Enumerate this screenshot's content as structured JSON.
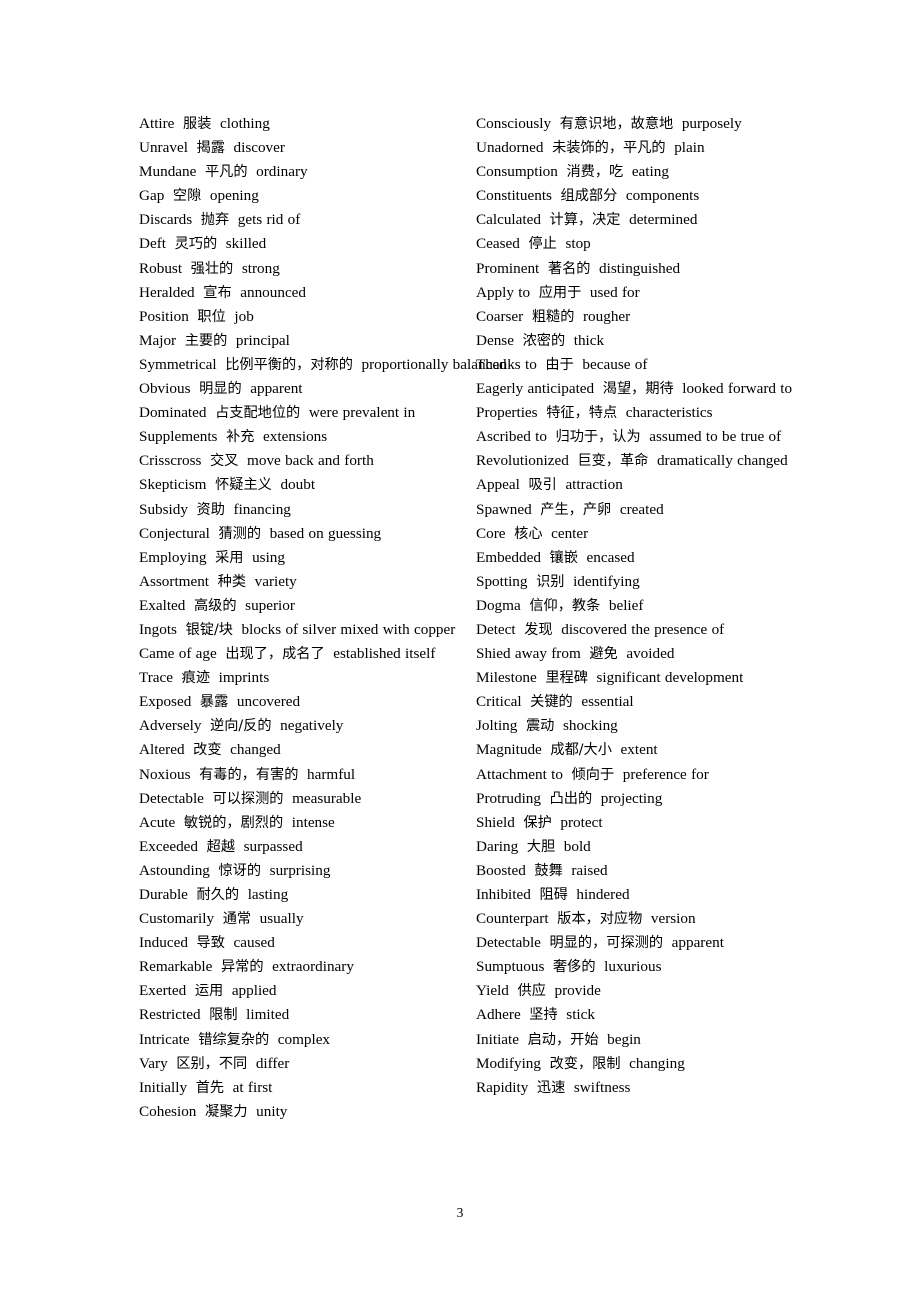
{
  "document": {
    "type": "vocabulary-glossary-page",
    "page_number": "3",
    "layout": "two-column",
    "background_color": "#ffffff",
    "text_color": "#000000"
  },
  "left_column": [
    {
      "en": "Attire",
      "cn": "服装",
      "syn": "clothing",
      "wrap": false
    },
    {
      "en": "Unravel",
      "cn": "揭露",
      "syn": "discover",
      "wrap": false
    },
    {
      "en": "Mundane",
      "cn": "平凡的",
      "syn": "ordinary",
      "wrap": false
    },
    {
      "en": "Gap",
      "cn": "空隙",
      "syn": "opening",
      "wrap": false
    },
    {
      "en": "Discards",
      "cn": "抛弃",
      "syn": "gets rid of",
      "wrap": false
    },
    {
      "en": "Deft",
      "cn": "灵巧的",
      "syn": "skilled",
      "wrap": false
    },
    {
      "en": "Robust",
      "cn": "强壮的",
      "syn": "strong",
      "wrap": false
    },
    {
      "en": "Heralded",
      "cn": "宣布",
      "syn": "announced",
      "wrap": false
    },
    {
      "en": "Position",
      "cn": "职位",
      "syn": "job",
      "wrap": false
    },
    {
      "en": "Major",
      "cn": "主要的",
      "syn": "principal",
      "wrap": false
    },
    {
      "en": "Symmetrical",
      "cn": "比例平衡的，对称的",
      "syn": "proportionally balanced",
      "wrap": true
    },
    {
      "en": "Obvious",
      "cn": "明显的",
      "syn": "apparent",
      "wrap": false
    },
    {
      "en": "Dominated",
      "cn": "占支配地位的",
      "syn": "were prevalent in",
      "wrap": false
    },
    {
      "en": "Supplements",
      "cn": "补充",
      "syn": "extensions",
      "wrap": false
    },
    {
      "en": "Crisscross",
      "cn": "交叉",
      "syn": "move back and forth",
      "wrap": false
    },
    {
      "en": "Skepticism",
      "cn": "怀疑主义",
      "syn": "doubt",
      "wrap": false
    },
    {
      "en": "Subsidy",
      "cn": "资助",
      "syn": "financing",
      "wrap": false
    },
    {
      "en": "Conjectural",
      "cn": "猜测的",
      "syn": "based on guessing",
      "wrap": false
    },
    {
      "en": "Employing",
      "cn": "采用",
      "syn": "using",
      "wrap": false
    },
    {
      "en": "Assortment",
      "cn": "种类",
      "syn": "variety",
      "wrap": false
    },
    {
      "en": "Exalted",
      "cn": "高级的",
      "syn": "superior",
      "wrap": false
    },
    {
      "en": "Ingots",
      "cn": "银锭/块",
      "syn": "blocks of silver mixed with copper",
      "wrap": true
    },
    {
      "en": "Came of age",
      "cn": "出现了，成名了",
      "syn": "established itself",
      "wrap": false
    },
    {
      "en": "Trace",
      "cn": "痕迹",
      "syn": "imprints",
      "wrap": false
    },
    {
      "en": "Exposed",
      "cn": "暴露",
      "syn": "uncovered",
      "wrap": false
    },
    {
      "en": "Adversely",
      "cn": "逆向/反的",
      "syn": "negatively",
      "wrap": false
    },
    {
      "en": "Altered",
      "cn": "改变",
      "syn": "changed",
      "wrap": false
    },
    {
      "en": "Noxious",
      "cn": "有毒的，有害的",
      "syn": "harmful",
      "wrap": false
    },
    {
      "en": "Detectable",
      "cn": "可以探测的",
      "syn": "measurable",
      "wrap": false
    },
    {
      "en": "Acute",
      "cn": "敏锐的，剧烈的",
      "syn": "intense",
      "wrap": false
    },
    {
      "en": "Exceeded",
      "cn": "超越",
      "syn": "surpassed",
      "wrap": false
    },
    {
      "en": "Astounding",
      "cn": "惊讶的",
      "syn": "surprising",
      "wrap": false
    },
    {
      "en": "Durable",
      "cn": "耐久的",
      "syn": "lasting",
      "wrap": false
    },
    {
      "en": "Customarily",
      "cn": "通常",
      "syn": "usually",
      "wrap": false
    },
    {
      "en": "Induced",
      "cn": "导致",
      "syn": "caused",
      "wrap": false
    },
    {
      "en": "Remarkable",
      "cn": "异常的",
      "syn": "extraordinary",
      "wrap": false
    },
    {
      "en": "Exerted",
      "cn": "运用",
      "syn": "applied",
      "wrap": false
    },
    {
      "en": "Restricted",
      "cn": "限制",
      "syn": "limited",
      "wrap": false
    },
    {
      "en": "Intricate",
      "cn": "错综复杂的",
      "syn": "complex",
      "wrap": false
    },
    {
      "en": "Vary",
      "cn": "区别，不同",
      "syn": "differ",
      "wrap": false
    },
    {
      "en": "Initially",
      "cn": "首先",
      "syn": "at first",
      "wrap": false
    },
    {
      "en": "Cohesion",
      "cn": "凝聚力",
      "syn": "unity",
      "wrap": false
    }
  ],
  "right_column": [
    {
      "en": "Consciously",
      "cn": "有意识地，故意地",
      "syn": "purposely",
      "wrap": false
    },
    {
      "en": "Unadorned",
      "cn": "未装饰的，平凡的",
      "syn": "plain",
      "wrap": false
    },
    {
      "en": "Consumption",
      "cn": "消费，吃",
      "syn": "eating",
      "wrap": false
    },
    {
      "en": "Constituents",
      "cn": "组成部分",
      "syn": "components",
      "wrap": false
    },
    {
      "en": "Calculated",
      "cn": "计算，决定",
      "syn": "determined",
      "wrap": false
    },
    {
      "en": "Ceased",
      "cn": "停止",
      "syn": "stop",
      "wrap": false
    },
    {
      "en": "Prominent",
      "cn": "著名的",
      "syn": "distinguished",
      "wrap": false
    },
    {
      "en": "Apply to",
      "cn": "应用于",
      "syn": "used for",
      "wrap": false
    },
    {
      "en": "Coarser",
      "cn": "粗糙的",
      "syn": "rougher",
      "wrap": false
    },
    {
      "en": "Dense",
      "cn": "浓密的",
      "syn": "thick",
      "wrap": false
    },
    {
      "en": "Thanks to",
      "cn": "由于",
      "syn": "because of",
      "wrap": false
    },
    {
      "en": "Eagerly anticipated",
      "cn": "渴望，期待",
      "syn": "looked forward to",
      "wrap": true
    },
    {
      "en": "Properties",
      "cn": "特征，特点",
      "syn": "characteristics",
      "wrap": false
    },
    {
      "en": "Ascribed to",
      "cn": "归功于，认为",
      "syn": "assumed to be true of",
      "wrap": true
    },
    {
      "en": "Revolutionized",
      "cn": "巨变，革命",
      "syn": "dramatically changed",
      "wrap": true
    },
    {
      "en": "Appeal",
      "cn": "吸引",
      "syn": "attraction",
      "wrap": false
    },
    {
      "en": "Spawned",
      "cn": "产生，产卵",
      "syn": "created",
      "wrap": false
    },
    {
      "en": "Core",
      "cn": "核心",
      "syn": "center",
      "wrap": false
    },
    {
      "en": "Embedded",
      "cn": "镶嵌",
      "syn": "encased",
      "wrap": false
    },
    {
      "en": "Spotting",
      "cn": "识别",
      "syn": "identifying",
      "wrap": false
    },
    {
      "en": "Dogma",
      "cn": "信仰，教条",
      "syn": "belief",
      "wrap": false
    },
    {
      "en": "Detect",
      "cn": "发现",
      "syn": "discovered the presence of",
      "wrap": false
    },
    {
      "en": "Shied away from",
      "cn": "避免",
      "syn": "avoided",
      "wrap": false
    },
    {
      "en": "Milestone",
      "cn": "里程碑",
      "syn": "significant development",
      "wrap": false
    },
    {
      "en": "Critical",
      "cn": "关键的",
      "syn": "essential",
      "wrap": false
    },
    {
      "en": "Jolting",
      "cn": "震动",
      "syn": "shocking",
      "wrap": false
    },
    {
      "en": "Magnitude",
      "cn": "成都/大小",
      "syn": "extent",
      "wrap": false
    },
    {
      "en": "Attachment to",
      "cn": "倾向于",
      "syn": "preference for",
      "wrap": false
    },
    {
      "en": "Protruding",
      "cn": "凸出的",
      "syn": "projecting",
      "wrap": false
    },
    {
      "en": "Shield",
      "cn": "保护",
      "syn": "protect",
      "wrap": false
    },
    {
      "en": "Daring",
      "cn": "大胆",
      "syn": "bold",
      "wrap": false
    },
    {
      "en": "Boosted",
      "cn": "鼓舞",
      "syn": "raised",
      "wrap": false
    },
    {
      "en": "Inhibited",
      "cn": "阻碍",
      "syn": "hindered",
      "wrap": false
    },
    {
      "en": "Counterpart",
      "cn": "版本，对应物",
      "syn": "version",
      "wrap": false
    },
    {
      "en": "Detectable",
      "cn": "明显的，可探测的",
      "syn": "apparent",
      "wrap": false
    },
    {
      "en": "Sumptuous",
      "cn": "奢侈的",
      "syn": "luxurious",
      "wrap": false
    },
    {
      "en": "Yield",
      "cn": "供应",
      "syn": "provide",
      "wrap": false
    },
    {
      "en": "Adhere",
      "cn": "坚持",
      "syn": "stick",
      "wrap": false
    },
    {
      "en": "Initiate",
      "cn": "启动，开始",
      "syn": "begin",
      "wrap": false
    },
    {
      "en": "Modifying",
      "cn": "改变，限制",
      "syn": "changing",
      "wrap": false
    },
    {
      "en": "Rapidity",
      "cn": "迅速",
      "syn": "swiftness",
      "wrap": false
    }
  ]
}
